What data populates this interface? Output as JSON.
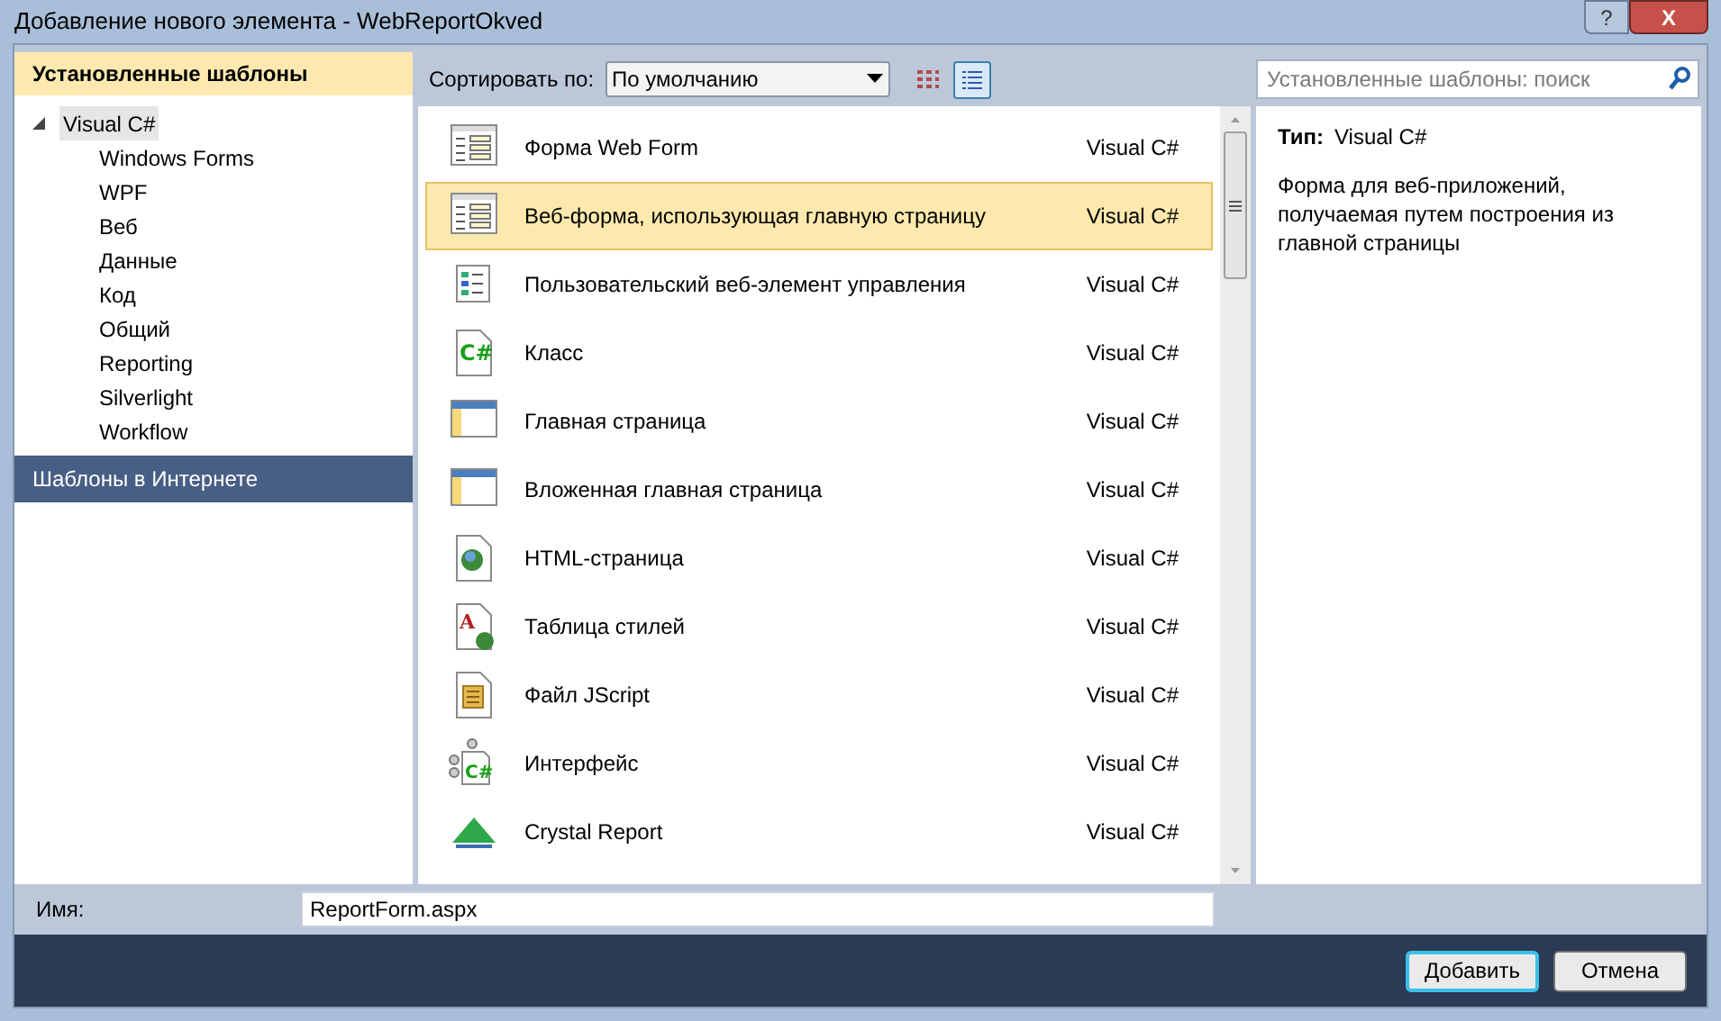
{
  "window": {
    "title": "Добавление нового элемента - WebReportOkved",
    "buttons": [
      "?",
      "X"
    ]
  },
  "sidebar": {
    "header": "Установленные шаблоны",
    "tree": [
      {
        "label": "Visual C#",
        "expanded": true,
        "selected": true,
        "children": [
          {
            "label": "Windows Forms",
            "selected": false
          },
          {
            "label": "WPF",
            "selected": false
          },
          {
            "label": "Веб",
            "selected": false
          },
          {
            "label": "Данные",
            "selected": false
          },
          {
            "label": "Код",
            "selected": false
          },
          {
            "label": "Общий",
            "selected": false
          },
          {
            "label": "Reporting",
            "selected": false
          },
          {
            "label": "Silverlight",
            "selected": false
          },
          {
            "label": "Workflow",
            "selected": false
          }
        ]
      }
    ],
    "online": "Шаблоны в Интернете"
  },
  "toolbar": {
    "sort_label": "Сортировать по:",
    "sort_value": "По умолчанию",
    "views": [
      {
        "kind": "medium",
        "selected": false
      },
      {
        "kind": "small",
        "selected": true
      }
    ]
  },
  "search": {
    "placeholder": "Установленные шаблоны: поиск"
  },
  "templates": [
    {
      "kind": "form",
      "name": "Форма Web Form",
      "lang": "Visual C#",
      "selected": false
    },
    {
      "kind": "form",
      "name": "Веб-форма, использующая главную страницу",
      "lang": "Visual C#",
      "selected": true
    },
    {
      "kind": "control",
      "name": "Пользовательский веб-элемент управления",
      "lang": "Visual C#",
      "selected": false
    },
    {
      "kind": "class",
      "name": "Класс",
      "lang": "Visual C#",
      "selected": false,
      "icon_text": "C#"
    },
    {
      "kind": "master",
      "name": "Главная страница",
      "lang": "Visual C#",
      "selected": false
    },
    {
      "kind": "master",
      "name": "Вложенная главная страница",
      "lang": "Visual C#",
      "selected": false
    },
    {
      "kind": "html",
      "name": "HTML-страница",
      "lang": "Visual C#",
      "selected": false
    },
    {
      "kind": "css",
      "name": "Таблица стилей",
      "lang": "Visual C#",
      "selected": false,
      "icon_text": "A"
    },
    {
      "kind": "script",
      "name": "Файл JScript",
      "lang": "Visual C#",
      "selected": false
    },
    {
      "kind": "interface",
      "name": "Интерфейс",
      "lang": "Visual C#",
      "selected": false,
      "icon_text": "C#"
    },
    {
      "kind": "report",
      "name": "Crystal Report",
      "lang": "Visual C#",
      "selected": false
    }
  ],
  "details": {
    "type_label": "Тип:",
    "type_value": "Visual C#",
    "description": "Форма для веб-приложений, получаемая путем построения из главной страницы"
  },
  "name_field": {
    "label": "Имя:",
    "value": "ReportForm.aspx"
  },
  "buttons": [
    {
      "label": "Добавить",
      "default": true
    },
    {
      "label": "Отмена",
      "default": false
    }
  ]
}
